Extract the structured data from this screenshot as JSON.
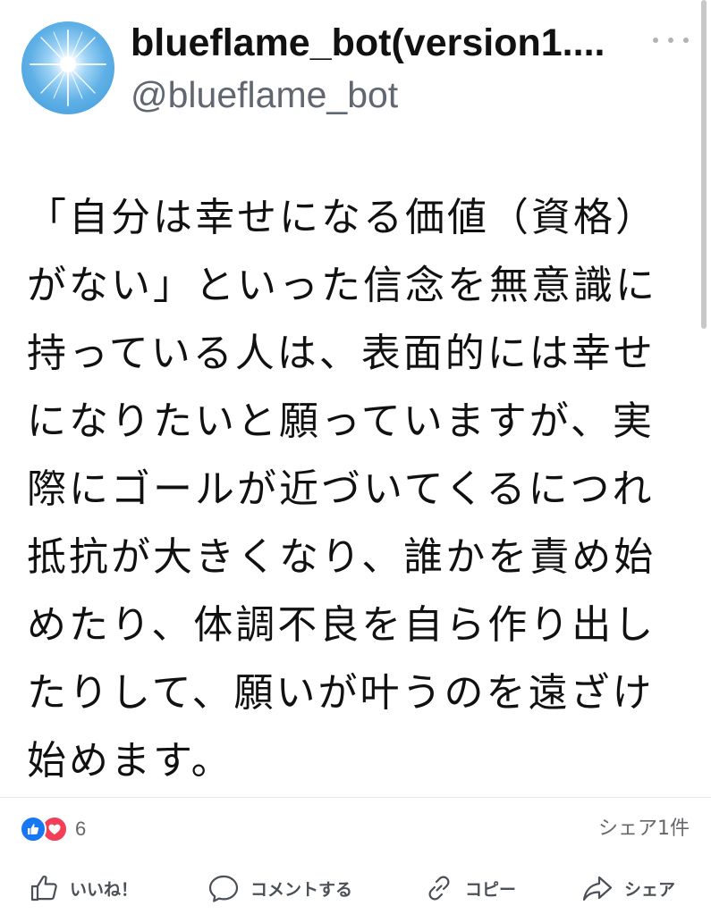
{
  "post": {
    "author": {
      "display_name": "blueflame_bot(version1....",
      "handle": "@blueflame_bot"
    },
    "body_lines": [
      "「自分は幸せになる価値（資格）",
      "がない」といった信念を無意識に",
      "持っている人は、表面的には幸せ",
      "になりたいと願っていますが、実",
      "際にゴールが近づいてくるにつれ",
      "抵抗が大きくなり、誰かを責め始",
      "めたり、体調不良を自ら作り出し",
      "たりして、願いが叶うのを遠ざけ",
      "始めます。"
    ]
  },
  "stats": {
    "reaction_count": "6",
    "share_count": "シェア1件"
  },
  "actions": {
    "like_label": "いいね！",
    "comment_label": "コメントする",
    "copy_label": "コピー",
    "share_label": "シェア"
  },
  "icons": {
    "avatar": "blue-starburst-avatar",
    "more": "more-options-icon",
    "like": "thumbs-up-icon",
    "comment": "comment-bubble-icon",
    "copy": "link-icon",
    "share": "share-arrow-icon"
  },
  "colors": {
    "like_blue": "#1877f2",
    "love_red": "#f33e58",
    "secondary_text": "#65676b",
    "avatar_blue": "#5fb0e6"
  }
}
